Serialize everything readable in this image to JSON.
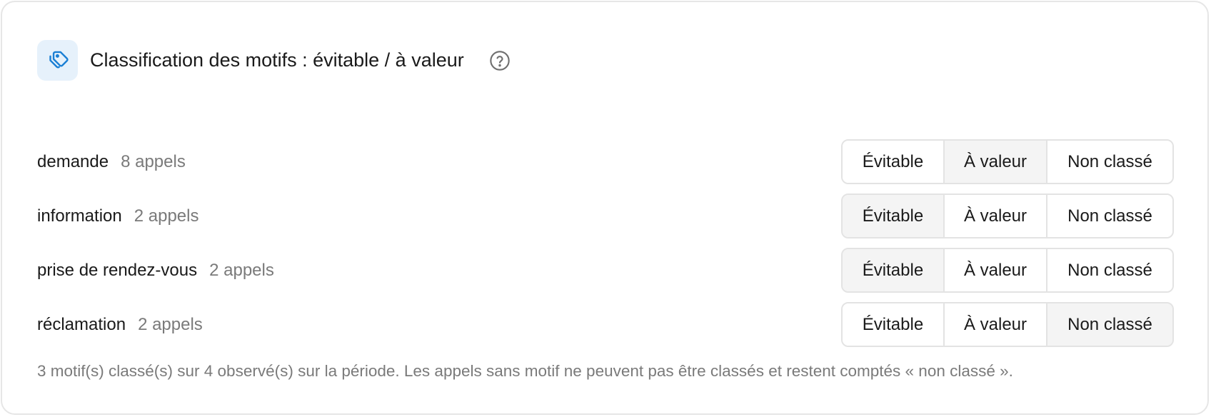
{
  "header": {
    "title": "Classification des motifs : évitable / à valeur",
    "icon": "tags-icon",
    "help_icon": "question-circle-icon",
    "accent_color": "#1a7fd4"
  },
  "options": [
    "Évitable",
    "À valeur",
    "Non classé"
  ],
  "rows": [
    {
      "motif": "demande",
      "count": "8 appels",
      "selected": "À valeur"
    },
    {
      "motif": "information",
      "count": "2 appels",
      "selected": "Évitable"
    },
    {
      "motif": "prise de rendez-vous",
      "count": "2 appels",
      "selected": "Évitable"
    },
    {
      "motif": "réclamation",
      "count": "2 appels",
      "selected": "Non classé"
    }
  ],
  "footnote": "3 motif(s) classé(s) sur 4 observé(s) sur la période. Les appels sans motif ne peuvent pas être classés et restent comptés « non classé »."
}
